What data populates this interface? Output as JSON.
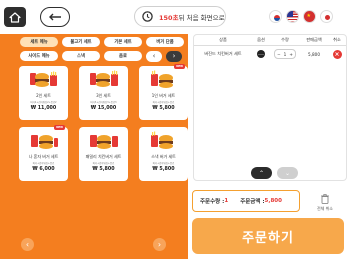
{
  "header": {
    "timer_seconds": "150초",
    "timer_text": " 뒤 처음 화면으로",
    "languages": [
      "korean-flag-icon",
      "usa-flag-icon",
      "china-flag-icon",
      "japan-flag-icon"
    ]
  },
  "categories": {
    "row1": [
      "세트 메뉴",
      "불고기 세트",
      "기본 세트",
      "버거 단품"
    ],
    "row2": [
      "사이드 메뉴",
      "스낵",
      "음료",
      "",
      "‹",
      "›"
    ]
  },
  "menu": [
    {
      "name": "2인 세트",
      "desc": "버거2+감자튀김2+음료2",
      "price": "₩ 11,000",
      "badge": ""
    },
    {
      "name": "3인 세트",
      "desc": "버거3+감자튀김3+음료3",
      "price": "₩ 15,000",
      "badge": ""
    },
    {
      "name": "1인 버거 세트",
      "desc": "버거+감자튀김+음료",
      "price": "₩ 5,800",
      "badge": "NEW"
    },
    {
      "name": "나 혼자 버거 세트",
      "desc": "버거+감자튀김+음료",
      "price": "₩ 6,000",
      "badge": "NEW"
    },
    {
      "name": "패밀리 치킨버거 세트",
      "desc": "버거+감자튀김+음료",
      "price": "₩ 5,800",
      "badge": ""
    },
    {
      "name": "스낵 버거 세트",
      "desc": "버거+감자튀김+음료",
      "price": "₩ 5,800",
      "badge": ""
    }
  ],
  "cart": {
    "headers": [
      "상품",
      "옵션",
      "수량",
      "판매금액",
      "취소"
    ],
    "items": [
      {
        "name": "버진드 치킨버거 세트",
        "qty": "1",
        "price": "5,800"
      }
    ]
  },
  "summary": {
    "qty_label": "주문수량 : ",
    "qty_value": "1",
    "amount_label": "주문금액 : ",
    "amount_value": "5,800"
  },
  "clear_label": "전체 취소",
  "order_label": "주문하기",
  "colors": {
    "accent": "#f47e1f",
    "order": "#f7a84b",
    "danger": "#e53935"
  }
}
